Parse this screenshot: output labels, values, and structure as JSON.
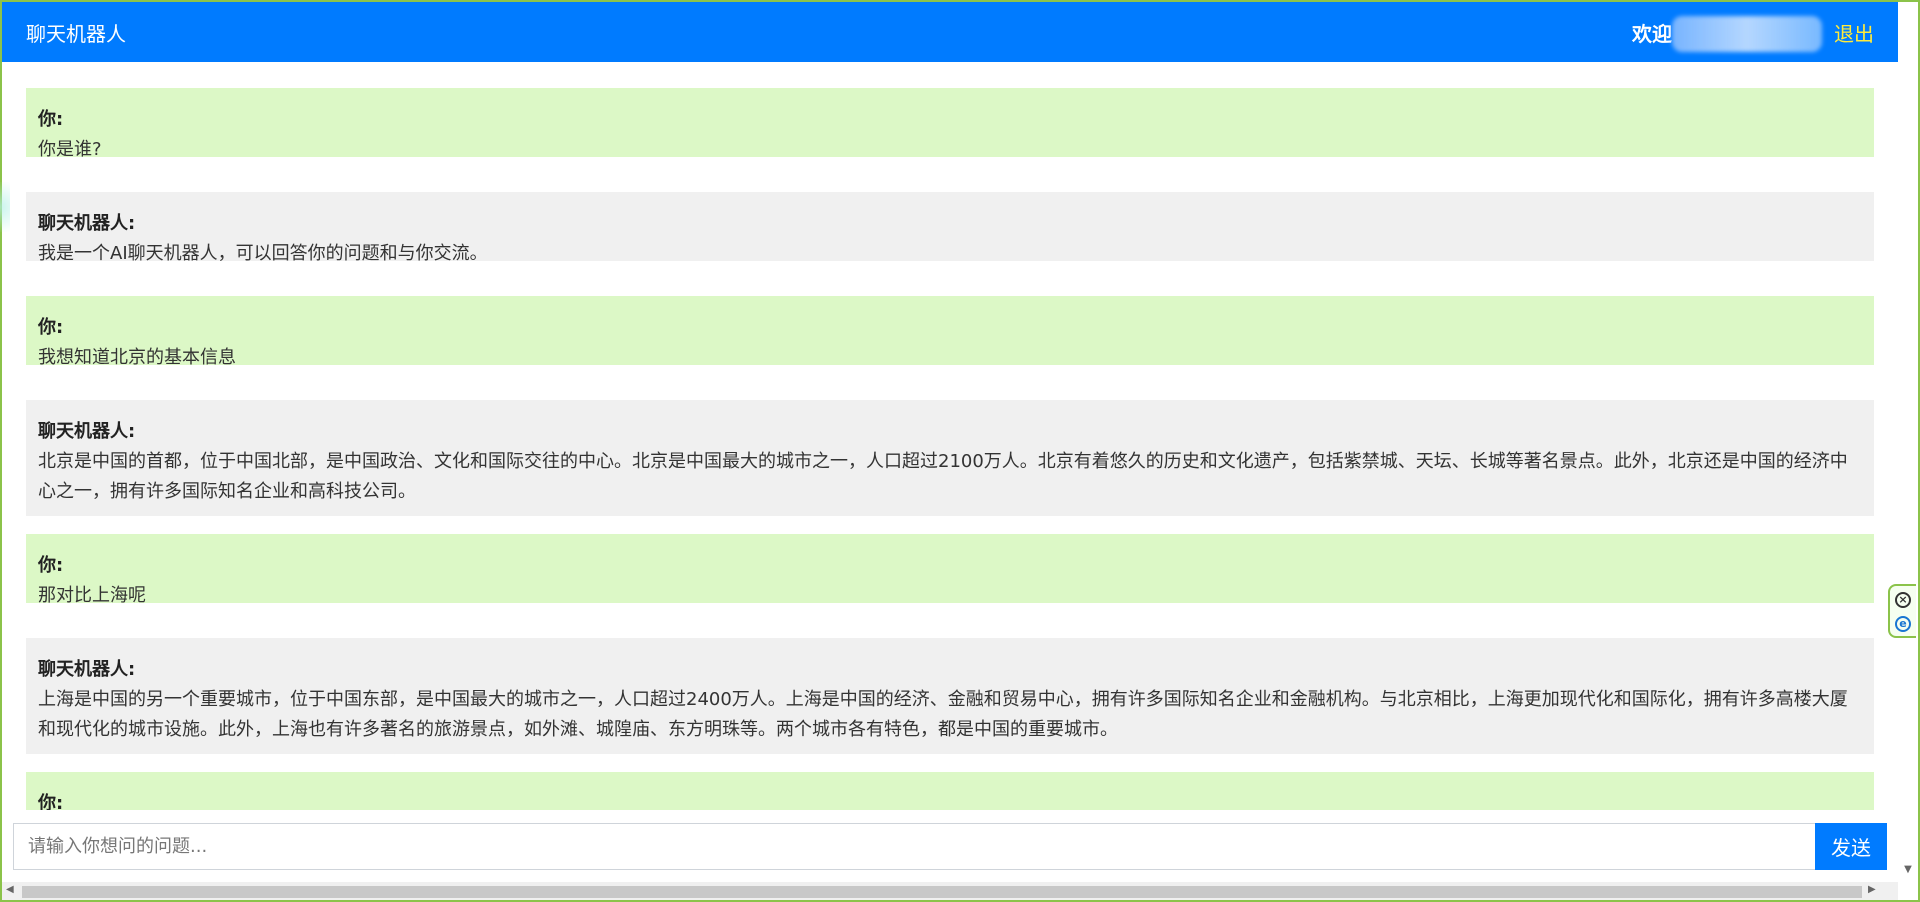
{
  "header": {
    "title": "聊天机器人",
    "welcome": "欢迎",
    "logout": "退出"
  },
  "messages": [
    {
      "sender": "你:",
      "text": "你是谁?"
    },
    {
      "sender": "聊天机器人:",
      "text": "我是一个AI聊天机器人，可以回答你的问题和与你交流。"
    },
    {
      "sender": "你:",
      "text": "我想知道北京的基本信息"
    },
    {
      "sender": "聊天机器人:",
      "text": "北京是中国的首都，位于中国北部，是中国政治、文化和国际交往的中心。北京是中国最大的城市之一，人口超过2100万人。北京有着悠久的历史和文化遗产，包括紫禁城、天坛、长城等著名景点。此外，北京还是中国的经济中心之一，拥有许多国际知名企业和高科技公司。"
    },
    {
      "sender": "你:",
      "text": "那对比上海呢"
    },
    {
      "sender": "聊天机器人:",
      "text": "上海是中国的另一个重要城市，位于中国东部，是中国最大的城市之一，人口超过2400万人。上海是中国的经济、金融和贸易中心，拥有许多国际知名企业和金融机构。与北京相比，上海更加现代化和国际化，拥有许多高楼大厦和现代化的城市设施。此外，上海也有许多著名的旅游景点，如外滩、城隍庙、东方明珠等。两个城市各有特色，都是中国的重要城市。"
    },
    {
      "sender": "你:",
      "text": ""
    }
  ],
  "input": {
    "placeholder": "请输入你想问的问题...",
    "value": "",
    "send_label": "发送"
  },
  "widget": {
    "close_glyph": "×",
    "e_glyph": "e"
  },
  "colors": {
    "header_bg": "#007bff",
    "user_bubble": "#dcf8c6",
    "bot_bubble": "#f0f0f0",
    "logout": "#ffeb3b"
  }
}
